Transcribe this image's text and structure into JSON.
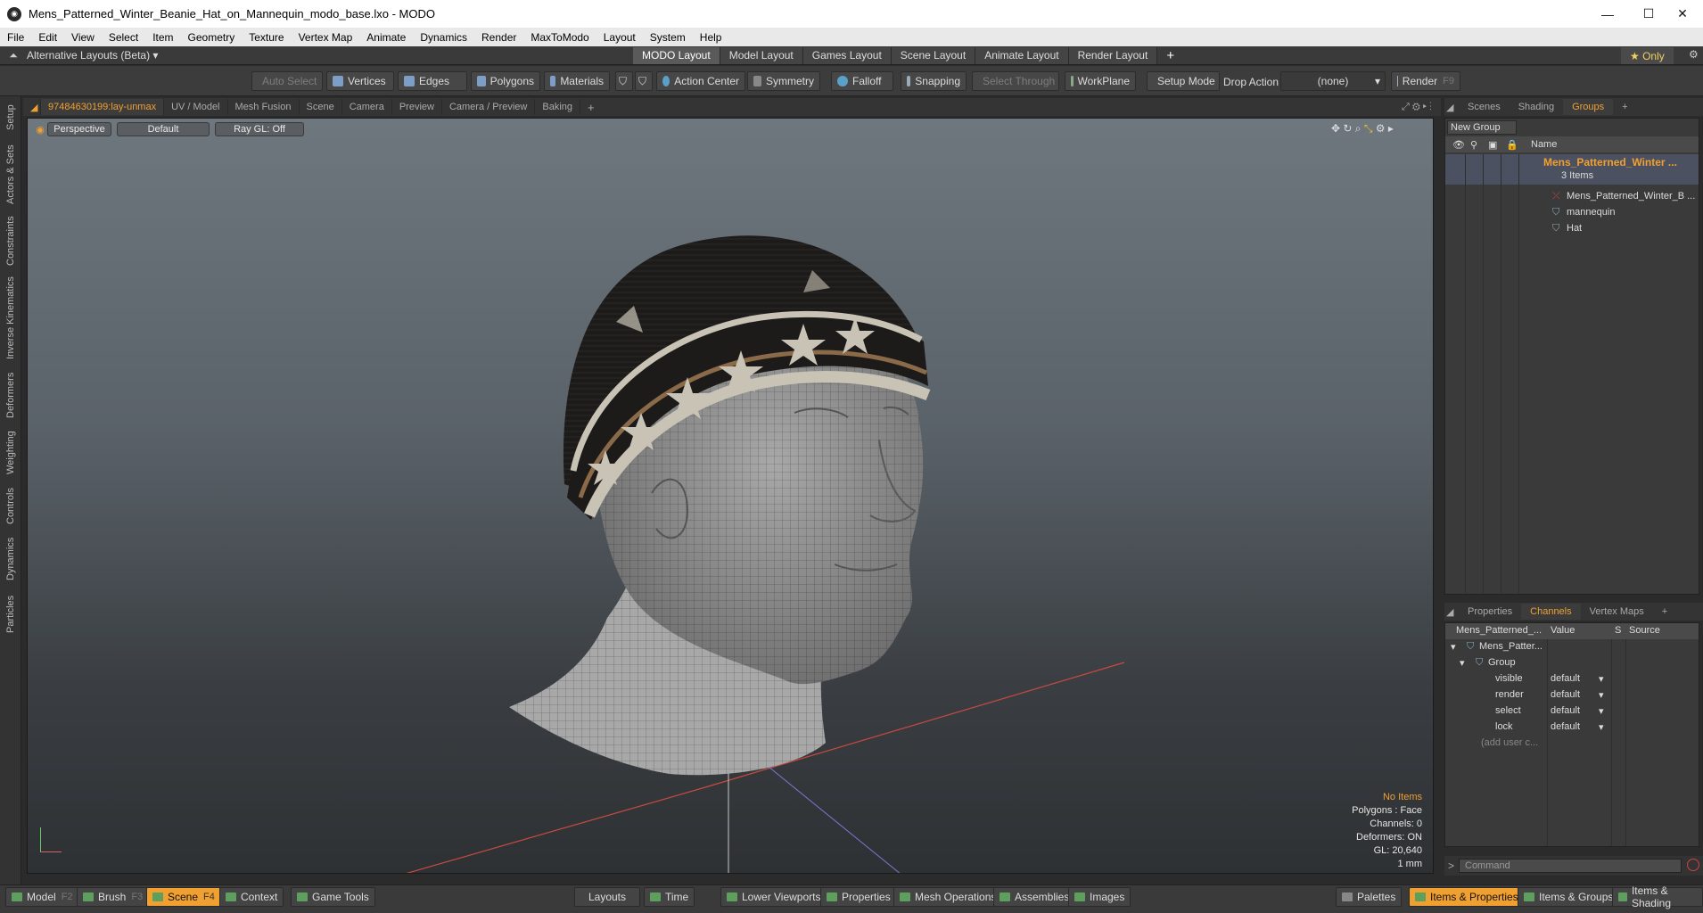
{
  "window": {
    "title": "Mens_Patterned_Winter_Beanie_Hat_on_Mannequin_modo_base.lxo - MODO",
    "minimize": "—",
    "maximize": "☐",
    "close": "✕"
  },
  "menu": [
    "File",
    "Edit",
    "View",
    "Select",
    "Item",
    "Geometry",
    "Texture",
    "Vertex Map",
    "Animate",
    "Dynamics",
    "Render",
    "MaxToModo",
    "Layout",
    "System",
    "Help"
  ],
  "layoutbar": {
    "alt_layouts": "Alternative Layouts (Beta)",
    "tabs": [
      "MODO Layout",
      "Model Layout",
      "Games Layout",
      "Scene Layout",
      "Animate Layout",
      "Render Layout"
    ],
    "add": "+",
    "only": "★ Only"
  },
  "toolbar": {
    "auto_select": "Auto Select",
    "vertices": "Vertices",
    "edges": "Edges",
    "polygons": "Polygons",
    "materials": "Materials",
    "action_center": "Action Center",
    "symmetry": "Symmetry",
    "falloff": "Falloff",
    "snapping": "Snapping",
    "select_through": "Select Through",
    "workplane": "WorkPlane",
    "setup_mode": "Setup Mode",
    "drop_action": "Drop Action",
    "none": "(none)",
    "render": "Render",
    "render_key": "F9"
  },
  "lefttabs": [
    "Setup",
    "Actors & Sets",
    "Constraints",
    "Inverse Kinematics",
    "Deformers",
    "Weighting",
    "Controls",
    "Dynamics",
    "Particles"
  ],
  "viewport_tabs": [
    "97484630199:lay-unmax",
    "UV / Model",
    "Mesh Fusion",
    "Scene",
    "Camera",
    "Preview",
    "Camera / Preview",
    "Baking",
    "+"
  ],
  "viewport": {
    "perspective": "Perspective",
    "default": "Default",
    "raygl": "Ray GL: Off",
    "info": {
      "no_items": "No Items",
      "polygons": "Polygons : Face",
      "channels": "Channels: 0",
      "deformers": "Deformers: ON",
      "gl": "GL: 20,640",
      "unit": "1 mm"
    }
  },
  "right_tabs": [
    "Scenes",
    "Shading",
    "Groups",
    "+"
  ],
  "groups": {
    "new_group": "New Group",
    "name_header": "Name",
    "root": "Mens_Patterned_Winter ...",
    "count": "3 Items",
    "items": [
      "Mens_Patterned_Winter_B ...",
      "mannequin",
      "Hat"
    ]
  },
  "prop_tabs": [
    "Properties",
    "Channels",
    "Vertex Maps",
    "+"
  ],
  "channels": {
    "col_name": "Mens_Patterned_...",
    "col_value": "Value",
    "col_s": "S",
    "col_source": "Source",
    "root": "Mens_Patter...",
    "group": "Group",
    "rows": [
      {
        "name": "visible",
        "value": "default"
      },
      {
        "name": "render",
        "value": "default"
      },
      {
        "name": "select",
        "value": "default"
      },
      {
        "name": "lock",
        "value": "default"
      }
    ],
    "add_user": "(add user c..."
  },
  "command": {
    "prompt": ">",
    "placeholder": "Command"
  },
  "bottombar": {
    "model": "Model",
    "model_key": "F2",
    "brush": "Brush",
    "brush_key": "F3",
    "scene": "Scene",
    "scene_key": "F4",
    "context": "Context",
    "game_tools": "Game Tools",
    "layouts": "Layouts",
    "time": "Time",
    "lower_viewports": "Lower Viewports",
    "properties": "Properties",
    "mesh_operations": "Mesh Operations",
    "assemblies": "Assemblies",
    "images": "Images",
    "palettes": "Palettes",
    "items_properties": "Items & Properties",
    "items_groups": "Items & Groups",
    "items_shading": "Items & Shading"
  },
  "colors": {
    "accent": "#f0a030",
    "hat_dark": "#1c1b1a",
    "hat_band": "#c9c3b6",
    "mesh": "#9a9a9a"
  }
}
